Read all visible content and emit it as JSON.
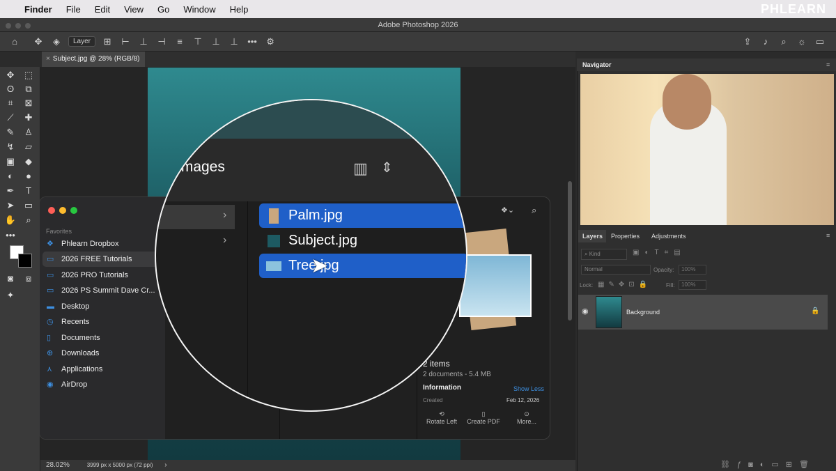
{
  "menubar": {
    "app": "Finder",
    "items": [
      "File",
      "Edit",
      "View",
      "Go",
      "Window",
      "Help"
    ],
    "watermark": "PHLEARN"
  },
  "window_title": "Adobe Photoshop 2026",
  "options_bar": {
    "layer_select": "Layer"
  },
  "document_tab": "Subject.jpg @ 28% (RGB/8)",
  "status": {
    "zoom": "28.02%",
    "doc_info": "3999 px x 5000 px (72 ppi)"
  },
  "finder": {
    "favorites_label": "Favorites",
    "favorites": [
      "Phlearn Dropbox",
      "2026 FREE Tutorials",
      "2026 PRO Tutorials",
      "2026 PS Summit Dave Cr...",
      "Desktop",
      "Recents",
      "Documents",
      "Downloads",
      "Applications",
      "AirDrop"
    ],
    "selected_favorite": "2026 FREE Tutorials",
    "preview": {
      "count": "2 items",
      "summary": "2 documents - 5.4 MB",
      "info_label": "Information",
      "show_less": "Show Less",
      "created_label": "Created",
      "created_value": "Feb 12, 2026"
    },
    "actions": [
      "Rotate Left",
      "Create PDF",
      "More..."
    ]
  },
  "magnifier": {
    "header": "Images",
    "files": [
      {
        "name": "Palm.jpg",
        "selected": true
      },
      {
        "name": "Subject.jpg",
        "selected": false
      },
      {
        "name": "Tree.jpg",
        "selected": true
      }
    ]
  },
  "navigator": {
    "title": "Navigator"
  },
  "layers": {
    "tabs": [
      "Layers",
      "Properties",
      "Adjustments"
    ],
    "kind": "Kind",
    "blend": "Normal",
    "opacity_label": "Opacity:",
    "opacity": "100%",
    "lock_label": "Lock:",
    "fill_label": "Fill:",
    "fill": "100%",
    "layer_name": "Background"
  },
  "colors": {
    "accent": "#1f5fc8",
    "finder_blue": "#3d8fe0"
  }
}
